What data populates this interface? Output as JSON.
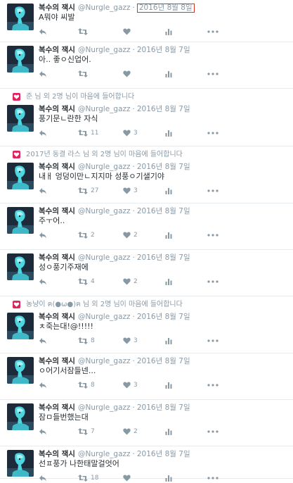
{
  "colors": {
    "accent": "#e0301e",
    "muted": "#8899a6",
    "text": "#292f33",
    "like": "#e0245e",
    "divider": "#e6ecf0"
  },
  "icons": {
    "reply": "reply-icon",
    "retweet": "retweet-icon",
    "like": "heart-icon",
    "analytics": "analytics-icon",
    "more": "more-icon",
    "liked_context": "heart-badge-icon"
  },
  "tweets": [
    {
      "author": "복수의 잭시",
      "handle": "@Nurgle_gazz",
      "date": "2016년 8월 8일",
      "date_highlighted": true,
      "text": "A뭐야 씨발",
      "retweets": "",
      "likes": "",
      "context": ""
    },
    {
      "author": "복수의 잭시",
      "handle": "@Nurgle_gazz",
      "date": "2016년 8월 7일",
      "date_highlighted": false,
      "text": "아.. 좋ㅇ신업어.",
      "retweets": "",
      "likes": "",
      "context": ""
    },
    {
      "author": "복수의 잭시",
      "handle": "@Nurgle_gazz",
      "date": "2016년 8월 7일",
      "date_highlighted": false,
      "text": "풍기문ㄴ란한 자식",
      "retweets": "11",
      "likes": "3",
      "context": "준 님 외 2명 님이 마음에 들어합니다"
    },
    {
      "author": "복수의 잭시",
      "handle": "@Nurgle_gazz",
      "date": "2016년 8월 7일",
      "date_highlighted": false,
      "text": "내ㅐ 엉덩이만ㄴ지지마 성풍ㅇ기샐기야",
      "retweets": "27",
      "likes": "3",
      "context": "2017년 동결 라스 님 외 2명 님이 마음에 들어합니다"
    },
    {
      "author": "복수의 잭시",
      "handle": "@Nurgle_gazz",
      "date": "2016년 8월 7일",
      "date_highlighted": false,
      "text": "주ㅜ어..",
      "retweets": "2",
      "likes": "2",
      "context": ""
    },
    {
      "author": "복수의 잭시",
      "handle": "@Nurgle_gazz",
      "date": "2016년 8월 7일",
      "date_highlighted": false,
      "text": "성ㅇ풍기주재에",
      "retweets": "4",
      "likes": "2",
      "context": ""
    },
    {
      "author": "복수의 잭시",
      "handle": "@Nurgle_gazz",
      "date": "2016년 8월 7일",
      "date_highlighted": false,
      "text": "ㅊ죽는대!@!!!!!",
      "retweets": "8",
      "likes": "3",
      "context": "농냥이 ฅ(●ω●)ฅ 님 외 2명 님이 마음에 들어합니다"
    },
    {
      "author": "복수의 잭시",
      "handle": "@Nurgle_gazz",
      "date": "2016년 8월 7일",
      "date_highlighted": false,
      "text": "ㅇ어기서잠들넨...",
      "retweets": "8",
      "likes": "3",
      "context": ""
    },
    {
      "author": "복수의 잭시",
      "handle": "@Nurgle_gazz",
      "date": "2016년 8월 7일",
      "date_highlighted": false,
      "text": "잠ㅁ들번했는대",
      "retweets": "7",
      "likes": "2",
      "context": ""
    },
    {
      "author": "복수의 잭시",
      "handle": "@Nurgle_gazz",
      "date": "2016년 8월 7일",
      "date_highlighted": false,
      "text": "선ㅍ풍가 나한태말걸엇어",
      "retweets": "18",
      "likes": "",
      "context": ""
    }
  ]
}
